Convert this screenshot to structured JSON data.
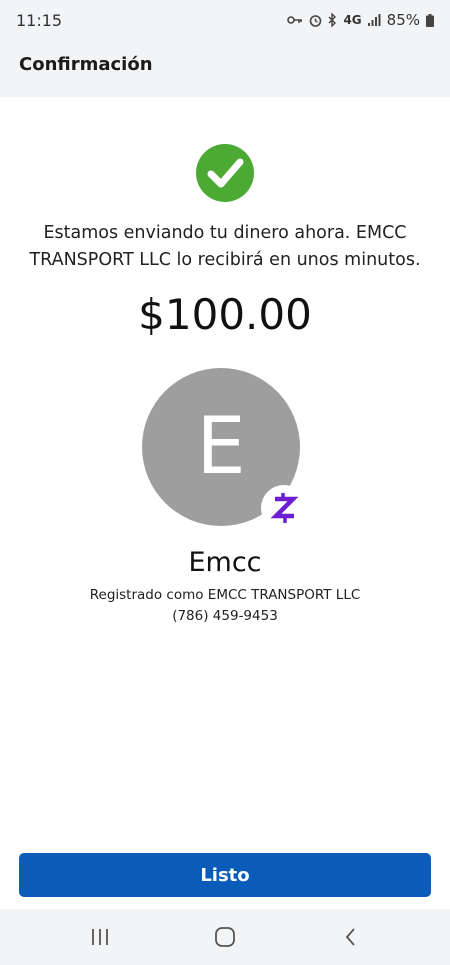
{
  "status_bar": {
    "time": "11:15",
    "network": "4G",
    "battery": "85%",
    "icons": [
      "key-icon",
      "alarm-icon",
      "bluetooth-icon",
      "network-4g-icon",
      "signal-icon",
      "battery-icon"
    ]
  },
  "header": {
    "title": "Confirmación"
  },
  "confirmation": {
    "message": "Estamos enviando tu dinero ahora. EMCC TRANSPORT LLC lo recibirá en unos minutos.",
    "amount": "$100.00",
    "check_color": "#4caa34"
  },
  "recipient": {
    "avatar_letter": "E",
    "avatar_color": "#9e9e9e",
    "badge_icon": "zelle-icon",
    "badge_color": "#6d1ed4",
    "name": "Emcc",
    "registered_as": "Registrado como EMCC TRANSPORT LLC",
    "phone": "(786) 459-9453"
  },
  "actions": {
    "done_label": "Listo",
    "button_color": "#0b5cb8"
  },
  "nav_bar": {
    "items": [
      "recent-apps-icon",
      "home-icon",
      "back-icon"
    ]
  }
}
